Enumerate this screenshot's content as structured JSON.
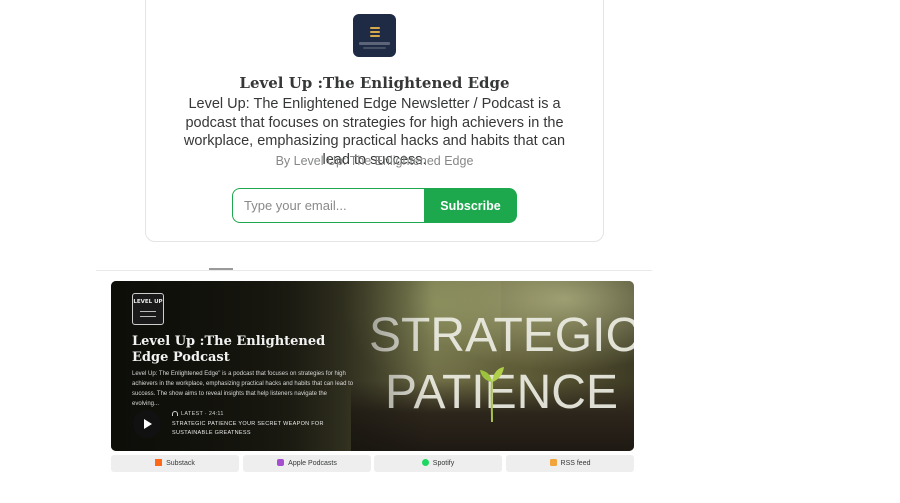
{
  "publication": {
    "title": "Level Up :The Enlightened Edge",
    "description": "Level Up: The Enlightened Edge Newsletter / Podcast is a podcast that focuses on strategies for high achievers in the workplace, emphasizing practical hacks and habits that can lead to success.",
    "byline": "By Level Up: The Enlightened Edge"
  },
  "subscribe_form": {
    "email_placeholder": "Type your email...",
    "button_label": "Subscribe",
    "accent_color": "#1ea84e"
  },
  "podcast": {
    "logo_text": "LEVEL UP",
    "title": "Level Up :The Enlightened Edge Podcast",
    "description": "Level Up: The Enlightened Edge\" is a podcast that focuses on strategies for high achievers in the workplace, emphasizing practical hacks and habits that can lead to success. The show aims to reveal insights that help listeners navigate the evolving...",
    "latest_label": "LATEST · 24:11",
    "episode_title": "STRATEGIC PATIENCE YOUR SECRET WEAPON FOR SUSTAINABLE GREATNESS",
    "artwork_line1": "STRATEGIC",
    "artwork_line2": "PATIENCE"
  },
  "platforms": [
    {
      "label": "Substack",
      "icon": "substack-icon",
      "color": "#ff6719"
    },
    {
      "label": "Apple Podcasts",
      "icon": "apple-podcasts-icon",
      "color": "#a64ed0"
    },
    {
      "label": "Spotify",
      "icon": "spotify-icon",
      "color": "#1ed760"
    },
    {
      "label": "RSS feed",
      "icon": "rss-icon",
      "color": "#f2a33a"
    }
  ]
}
